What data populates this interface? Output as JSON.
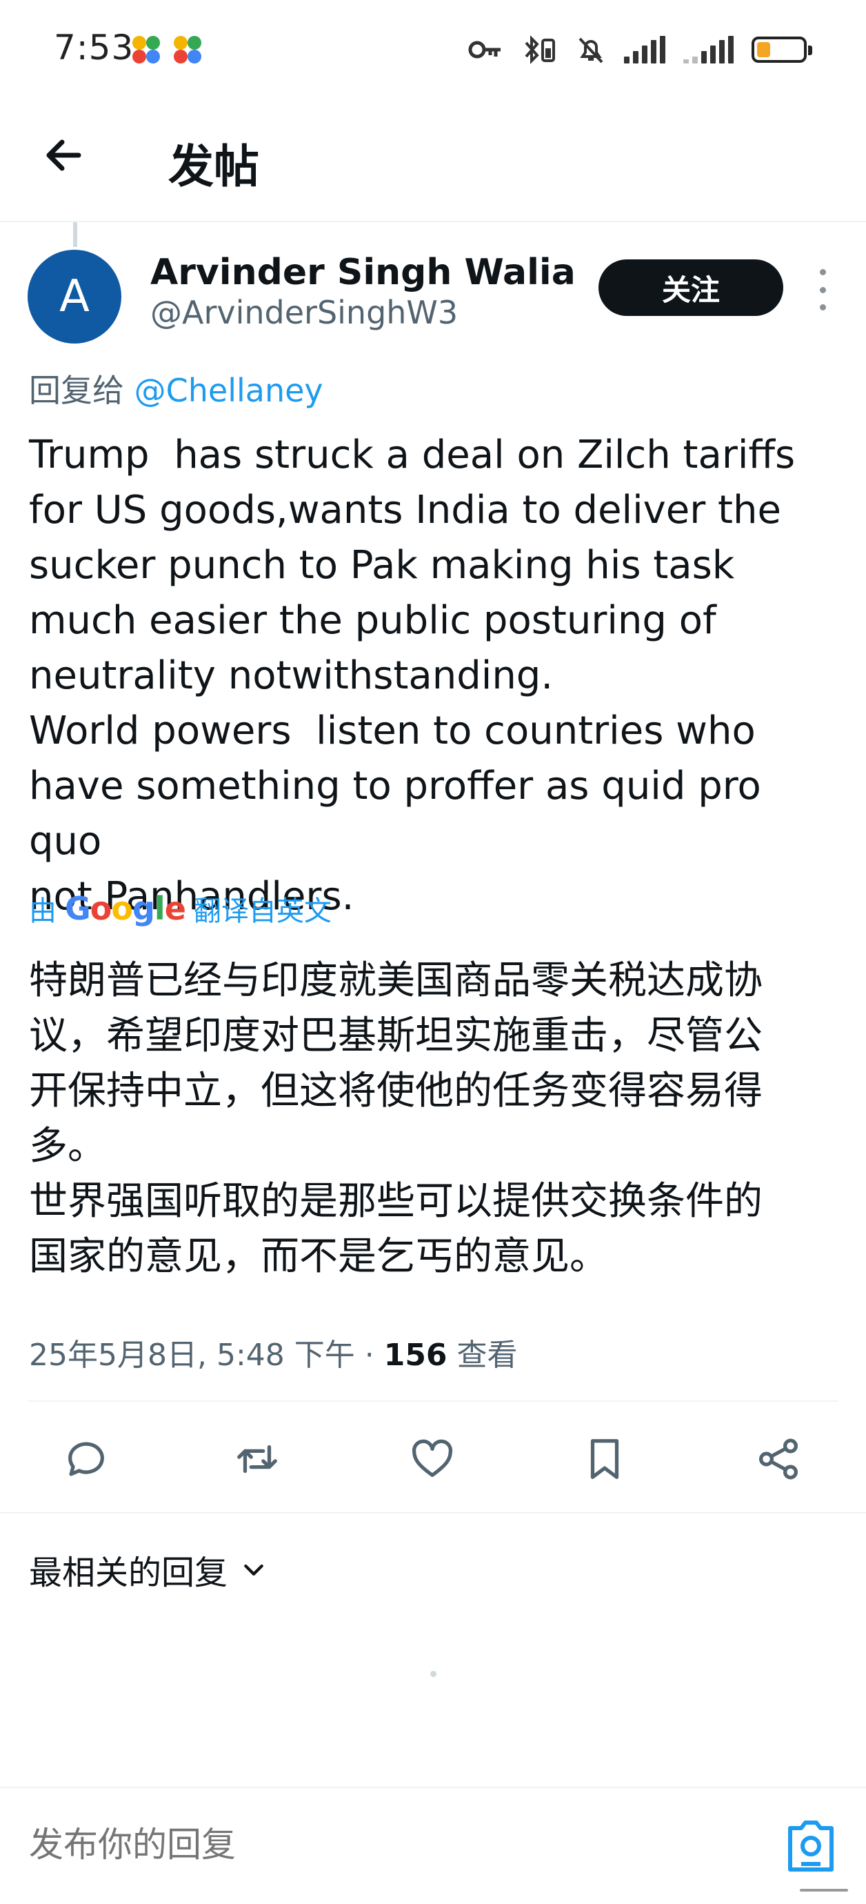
{
  "status_bar": {
    "time": "7:53",
    "battery_level": 0.3
  },
  "header": {
    "title": "发帖"
  },
  "tweet": {
    "author": {
      "avatar_letter": "A",
      "display_name": "Arvinder Singh Walia",
      "handle": "@ArvinderSinghW3"
    },
    "follow_label": "关注",
    "reply_to_prefix": "回复给",
    "reply_to_mention": "@Chellaney",
    "text": "Trump  has struck a deal on Zilch tariffs\nfor US goods,wants India to deliver the\nsucker punch to Pak making his task\nmuch easier the public posturing of\nneutrality notwithstanding.\nWorld powers  listen to countries who\nhave something to proffer as quid pro quo\nnot Panhandlers.",
    "translation": {
      "by": "由",
      "provider": "Google",
      "label": "翻译自英文",
      "text": "特朗普已经与印度就美国商品零关税达成协\n议，希望印度对巴基斯坦实施重击，尽管公\n开保持中立，但这将使他的任务变得容易得\n多。\n世界强国听取的是那些可以提供交换条件的\n国家的意见，而不是乞丐的意见。"
    },
    "timestamp": "25年5月8日, 5:48 下午 · ",
    "views_count": "156",
    "views_label": " 查看"
  },
  "replies": {
    "sort_label": "最相关的回复"
  },
  "composer": {
    "placeholder": "发布你的回复"
  }
}
